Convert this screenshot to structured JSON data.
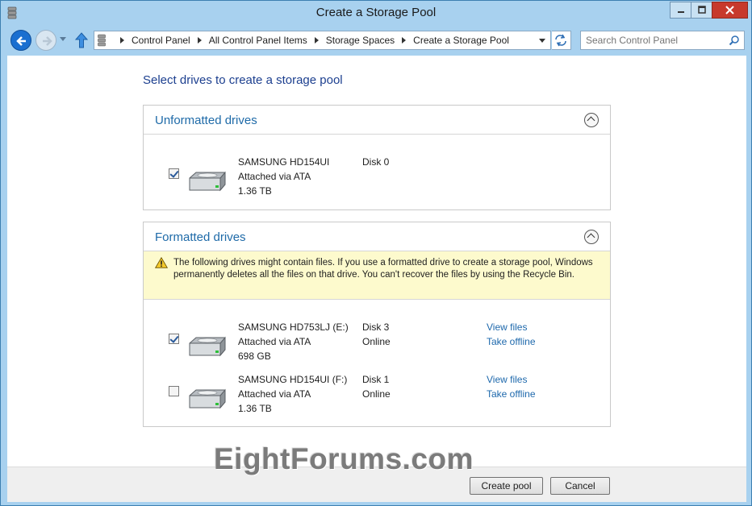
{
  "window": {
    "title": "Create a Storage Pool",
    "minimize_glyph": "🗕",
    "maximize_glyph": "🗖",
    "close_glyph": "✕"
  },
  "address_bar": {
    "breadcrumbs": [
      "Control Panel",
      "All Control Panel Items",
      "Storage Spaces",
      "Create a Storage Pool"
    ]
  },
  "search": {
    "placeholder": "Search Control Panel"
  },
  "page": {
    "heading": "Select drives to create a storage pool"
  },
  "unformatted": {
    "title": "Unformatted drives",
    "drives": [
      {
        "checked": true,
        "name": "SAMSUNG HD154UI",
        "connection": "Attached via ATA",
        "size": "1.36 TB",
        "disk": "Disk 0",
        "status": ""
      }
    ]
  },
  "formatted": {
    "title": "Formatted drives",
    "warning": "The following drives might contain files. If you use a formatted drive to create a storage pool, Windows permanently deletes all the files on that drive. You can't recover the files by using the Recycle Bin.",
    "drives": [
      {
        "checked": true,
        "name": "SAMSUNG HD753LJ (E:)",
        "connection": "Attached via ATA",
        "size": "698 GB",
        "disk": "Disk 3",
        "status": "Online",
        "link_view": "View files",
        "link_offline": "Take offline"
      },
      {
        "checked": false,
        "name": "SAMSUNG HD154UI (F:)",
        "connection": "Attached via ATA",
        "size": "1.36 TB",
        "disk": "Disk 1",
        "status": "Online",
        "link_view": "View files",
        "link_offline": "Take offline"
      }
    ]
  },
  "footer": {
    "create_label": "Create pool",
    "cancel_label": "Cancel"
  },
  "watermark": "EightForums.com",
  "colors": {
    "titlebar": "#a8d1ef",
    "link": "#1d68ac",
    "group_title": "#1e6aa8",
    "warning_bg": "#fdfacd",
    "close_button": "#c7392c"
  }
}
